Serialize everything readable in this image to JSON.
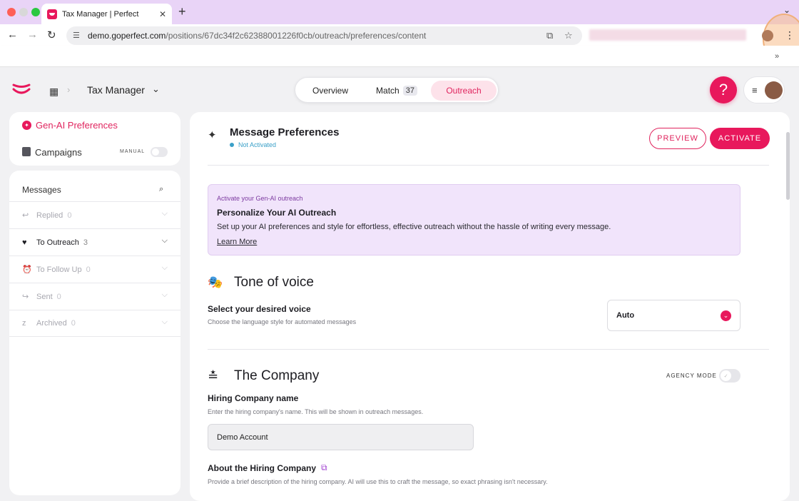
{
  "browser": {
    "tab_title": "Tax Manager | Perfect",
    "tab_close": "✕",
    "new_tab": "+",
    "tab_menu": "⌄",
    "url_domain": "demo.goperfect.com",
    "url_path": "/positions/67dc34f2c62388001226f0cb/outreach/preferences/content",
    "back": "←",
    "forward": "→",
    "reload": "↻",
    "menu": "⋮",
    "overflow": "»"
  },
  "header": {
    "job_title": "Tax Manager",
    "nav": {
      "overview": "Overview",
      "match": "Match",
      "match_count": "37",
      "outreach": "Outreach"
    },
    "help": "?",
    "menu": "≡"
  },
  "sidebar": {
    "genai": "Gen-AI Preferences",
    "campaigns": "Campaigns",
    "manual": "MANUAL",
    "messages_title": "Messages",
    "rows": [
      {
        "label": "Replied",
        "count": "0",
        "icon": "↩"
      },
      {
        "label": "To Outreach",
        "count": "3",
        "icon": "♥"
      },
      {
        "label": "To Follow Up",
        "count": "0",
        "icon": "⏰"
      },
      {
        "label": "Sent",
        "count": "0",
        "icon": "↪"
      },
      {
        "label": "Archived",
        "count": "0",
        "icon": "z"
      }
    ],
    "chevron": "⌵"
  },
  "main": {
    "title": "Message Preferences",
    "status": "Not Activated",
    "preview": "PREVIEW",
    "activate": "ACTIVATE",
    "promo": {
      "eyebrow": "Activate your Gen-AI outreach",
      "title": "Personalize Your AI Outreach",
      "desc": "Set up your AI preferences and style for effortless, effective outreach without the hassle of writing every message.",
      "link": "Learn More"
    },
    "tone": {
      "heading": "Tone of voice",
      "label": "Select your desired voice",
      "hint": "Choose the language style for automated messages",
      "value": "Auto"
    },
    "company": {
      "heading": "The Company",
      "agency_mode": "AGENCY MODE",
      "name_label": "Hiring Company name",
      "name_hint": "Enter the hiring company's name. This will be shown in outreach messages.",
      "name_value": "Demo Account",
      "about_label": "About the Hiring Company",
      "about_hint": "Provide a brief description of the hiring company. AI will use this to craft the message, so exact phrasing isn't necessary."
    }
  },
  "colors": {
    "accent": "#e8185c",
    "tabbar": "#e9d4f7",
    "promo_bg": "#f1e4fb",
    "status": "#3aa0c8"
  }
}
